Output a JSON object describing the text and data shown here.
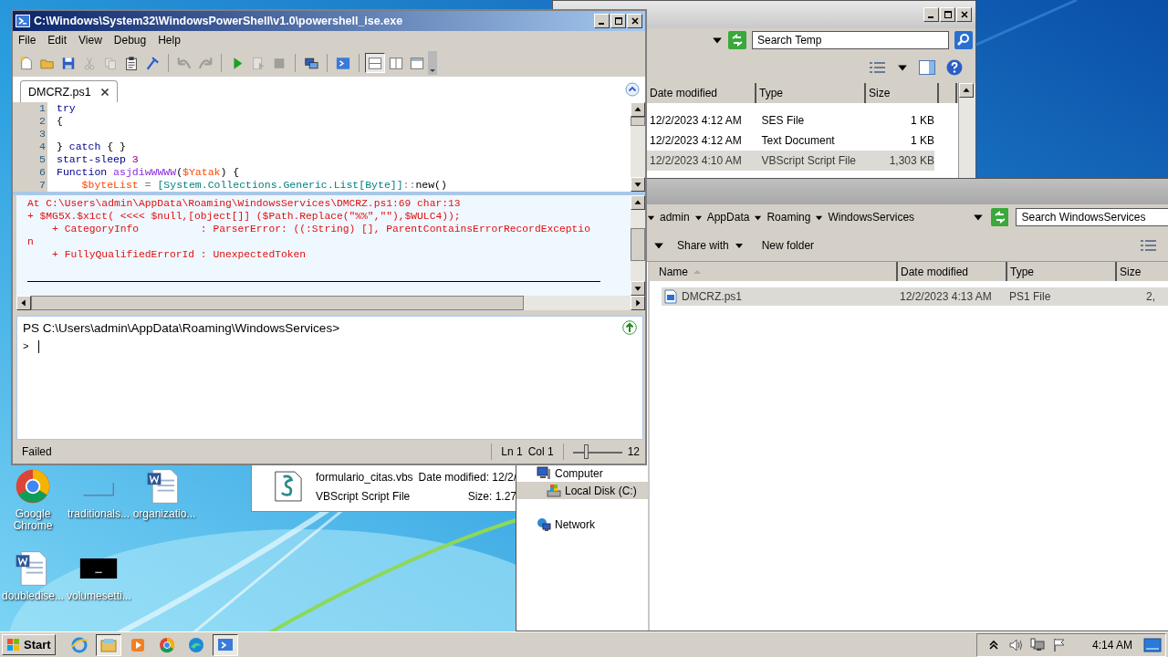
{
  "desktop_icons": [
    {
      "label": "Google Chrome",
      "kind": "chrome"
    },
    {
      "label": "traditionals...",
      "kind": "blank"
    },
    {
      "label": "organizatio...",
      "kind": "word"
    },
    {
      "label": "doubledise...",
      "kind": "word"
    },
    {
      "label": "volumesetti...",
      "kind": "console"
    }
  ],
  "explorer_temp": {
    "search": {
      "placeholder": "Search Temp"
    },
    "columns": [
      "Date modified",
      "Type",
      "Size"
    ],
    "rows": [
      {
        "date": "12/2/2023 4:12 AM",
        "type": "SES File",
        "size": "1 KB",
        "selected": false
      },
      {
        "date": "12/2/2023 4:12 AM",
        "type": "Text Document",
        "size": "1 KB",
        "selected": false
      },
      {
        "date": "12/2/2023 4:10 AM",
        "type": "VBScript Script File",
        "size": "1,303 KB",
        "selected": true
      }
    ]
  },
  "details_pane": {
    "name": "formulario_citas.vbs",
    "date_label": "Date modified: 12/2/",
    "type": "VBScript Script File",
    "size_label": "Size: 1.27"
  },
  "explorer_services": {
    "breadcrumb": [
      "admin",
      "AppData",
      "Roaming",
      "WindowsServices"
    ],
    "search": {
      "placeholder": "Search WindowsServices"
    },
    "toolbar": [
      "Share with",
      "New folder"
    ],
    "nav": [
      {
        "label": "Computer",
        "kind": "computer",
        "selected": false,
        "children": [
          {
            "label": "Local Disk (C:)",
            "kind": "disk",
            "selected": true
          }
        ]
      },
      {
        "label": "Network",
        "kind": "network",
        "selected": false
      }
    ],
    "columns": [
      "Name",
      "Date modified",
      "Type",
      "Size"
    ],
    "rows": [
      {
        "name": "DMCRZ.ps1",
        "date": "12/2/2023 4:13 AM",
        "type": "PS1 File",
        "size": "2,",
        "selected": true
      }
    ]
  },
  "ise": {
    "title": "C:\\Windows\\System32\\WindowsPowerShell\\v1.0\\powershell_ise.exe",
    "menu": [
      "File",
      "Edit",
      "View",
      "Debug",
      "Help"
    ],
    "toolbar": [
      {
        "kind": "new",
        "disabled": false
      },
      {
        "kind": "open",
        "disabled": false
      },
      {
        "kind": "save",
        "disabled": false
      },
      {
        "kind": "cut",
        "disabled": true
      },
      {
        "kind": "copy",
        "disabled": true
      },
      {
        "kind": "paste",
        "disabled": false
      },
      {
        "kind": "clear",
        "disabled": false
      },
      {
        "kind": "sep"
      },
      {
        "kind": "undo",
        "disabled": true
      },
      {
        "kind": "redo",
        "disabled": true
      },
      {
        "kind": "sep"
      },
      {
        "kind": "run",
        "disabled": false
      },
      {
        "kind": "run-selection",
        "disabled": true
      },
      {
        "kind": "stop",
        "disabled": true
      },
      {
        "kind": "sep"
      },
      {
        "kind": "remote",
        "disabled": false
      },
      {
        "kind": "sep"
      },
      {
        "kind": "shell",
        "disabled": false
      },
      {
        "kind": "sep"
      }
    ],
    "layouts": [
      {
        "kind": "top",
        "selected": true
      },
      {
        "kind": "right",
        "selected": false
      },
      {
        "kind": "max",
        "selected": false
      }
    ],
    "tab": {
      "label": "DMCRZ.ps1"
    },
    "script_lines": [
      {
        "number": "1",
        "tokens": [
          {
            "text": "try",
            "kind": "keyword"
          }
        ]
      },
      {
        "number": "2",
        "tokens": [
          {
            "text": "{",
            "kind": "plain"
          }
        ]
      },
      {
        "number": "3"
      },
      {
        "number": "4",
        "tokens": [
          {
            "text": "} ",
            "kind": "plain"
          },
          {
            "text": "catch",
            "kind": "keyword"
          },
          {
            "text": " { }",
            "kind": "plain"
          }
        ]
      },
      {
        "number": "5",
        "tokens": [
          {
            "text": "start-sleep",
            "kind": "keyword"
          },
          {
            "text": " 3",
            "kind": "number"
          }
        ]
      },
      {
        "number": "6",
        "tokens": [
          {
            "text": "Function",
            "kind": "keyword"
          },
          {
            "text": " asjdiwWWWW",
            "kind": "argument"
          },
          {
            "text": "(",
            "kind": "plain"
          },
          {
            "text": "$Yatak",
            "kind": "variable"
          },
          {
            "text": ") {",
            "kind": "plain"
          }
        ]
      },
      {
        "number": "7",
        "tokens": [
          {
            "text": "    $byteList",
            "kind": "variable"
          },
          {
            "text": " = ",
            "kind": "operator"
          },
          {
            "text": "[System.Collections.Generic.List[Byte]]",
            "kind": "type"
          },
          {
            "text": "::",
            "kind": "operator"
          },
          {
            "text": "new()",
            "kind": "plain"
          }
        ]
      }
    ],
    "output_lines": [
      "At C:\\Users\\admin\\AppData\\Roaming\\WindowsServices\\DMCRZ.ps1:69 char:13",
      "+ $MG5X.$x1ct( <<<< $null,[object[]] ($Path.Replace(\"%%\",\"\"),$WULC4));",
      "    + CategoryInfo          : ParserError: ((:String) [], ParentContainsErrorRecordExceptio",
      "n",
      "    + FullyQualifiedErrorId : UnexpectedToken"
    ],
    "prompt": "PS C:\\Users\\admin\\AppData\\Roaming\\WindowsServices>",
    "input_prompt": ">",
    "status": "Failed",
    "line": "Ln 1",
    "column": "Col 1",
    "zoom": {
      "reading": "12",
      "level": 0.27
    }
  },
  "taskbar": {
    "start": "Start",
    "apps": [
      {
        "kind": "ie",
        "selected": false
      },
      {
        "kind": "explorer",
        "selected": true
      },
      {
        "kind": "media",
        "selected": false
      },
      {
        "kind": "chrome",
        "selected": false
      },
      {
        "kind": "edge",
        "selected": false
      },
      {
        "kind": "ise",
        "selected": true
      }
    ],
    "clock": "4:14 AM"
  }
}
